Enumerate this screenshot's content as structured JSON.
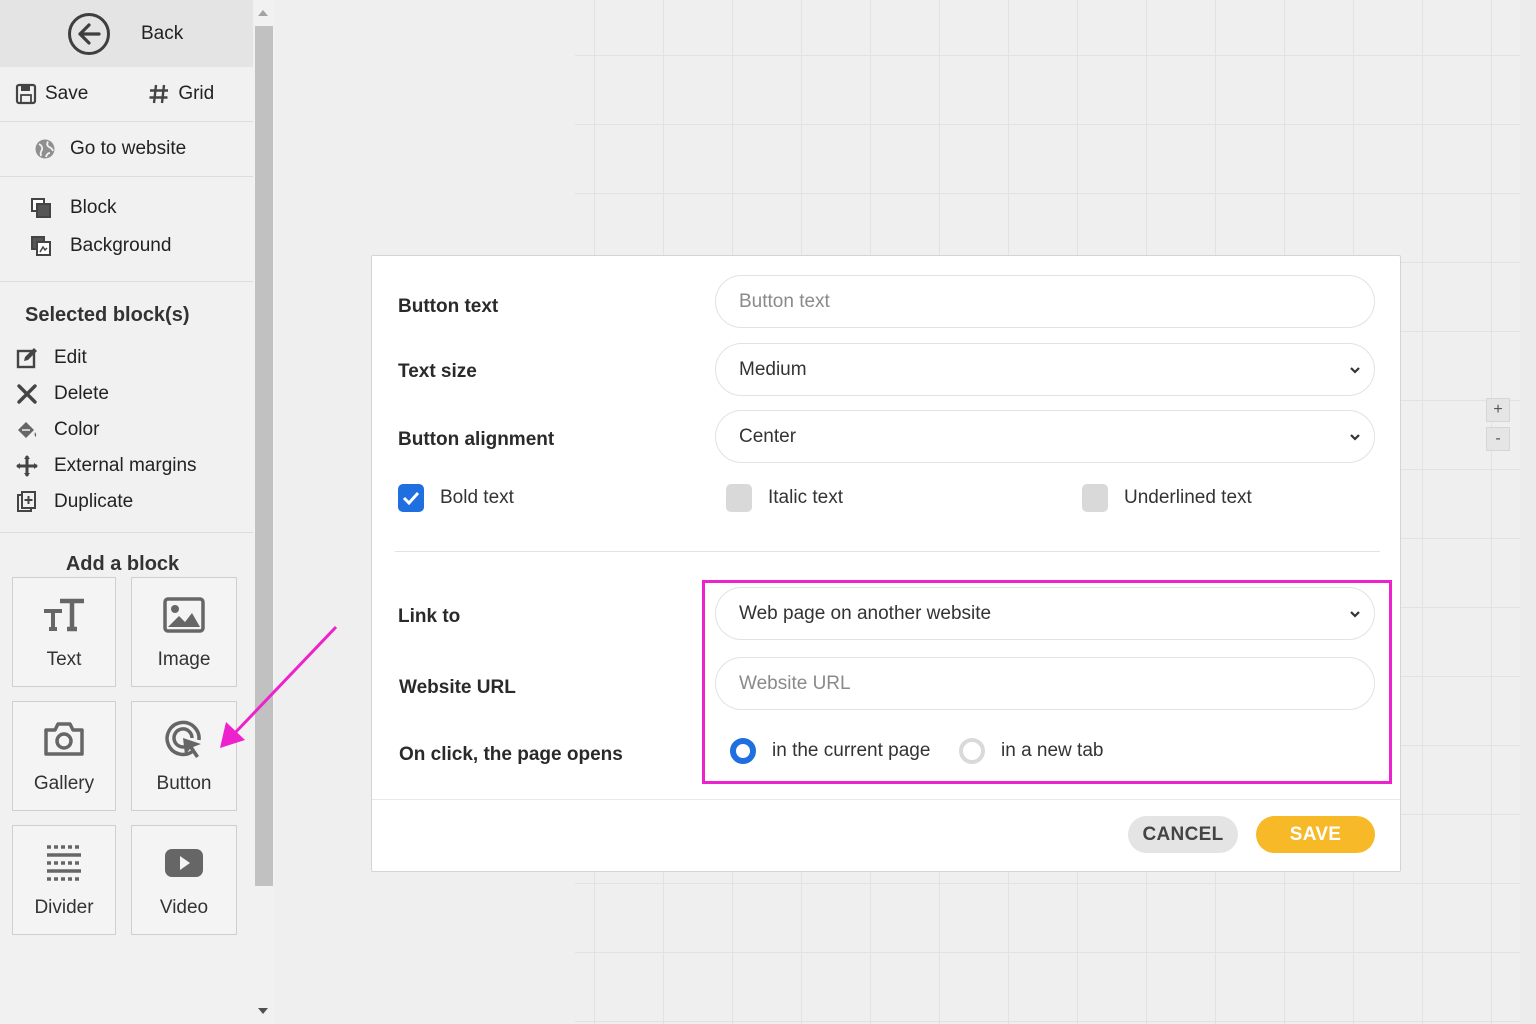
{
  "sidebar": {
    "back_label": "Back",
    "save_label": "Save",
    "grid_label": "Grid",
    "goto_label": "Go to website",
    "block_label": "Block",
    "background_label": "Background",
    "selected_title": "Selected block(s)",
    "selected_items": [
      "Edit",
      "Delete",
      "Color",
      "External margins",
      "Duplicate"
    ],
    "add_title": "Add a block",
    "tiles": [
      "Text",
      "Image",
      "Gallery",
      "Button",
      "Divider",
      "Video"
    ]
  },
  "canvas": {
    "zoom_in": "+",
    "zoom_out": "-"
  },
  "modal": {
    "button_text_label": "Button text",
    "button_text_placeholder": "Button text",
    "button_text_value": "",
    "text_size_label": "Text size",
    "text_size_value": "Medium",
    "alignment_label": "Button alignment",
    "alignment_value": "Center",
    "bold_label": "Bold text",
    "bold_checked": true,
    "italic_label": "Italic text",
    "italic_checked": false,
    "underline_label": "Underlined text",
    "underline_checked": false,
    "link_to_label": "Link to",
    "link_to_value": "Web page on another website",
    "url_label": "Website URL",
    "url_placeholder": "Website URL",
    "url_value": "",
    "onclick_label": "On click, the page opens",
    "radio_current": "in the current page",
    "radio_new_tab": "in a new tab",
    "radio_selected": "current",
    "cancel_label": "CANCEL",
    "save_label": "SAVE"
  },
  "colors": {
    "accent_blue": "#1f6fe0",
    "save_yellow": "#f7b928",
    "annotation_magenta": "#ee22cc"
  }
}
